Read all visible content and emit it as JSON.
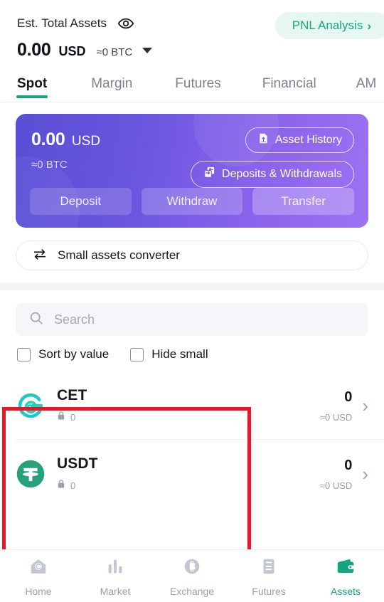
{
  "header": {
    "est_label": "Est. Total Assets",
    "eye_icon": "eye-icon",
    "amount": "0.00",
    "currency": "USD",
    "btc_equiv": "≈0 BTC",
    "caret_icon": "chevron-down-icon",
    "pnl_label": "PNL Analysis",
    "pnl_chevron": "›"
  },
  "tabs": [
    {
      "label": "Spot",
      "active": true
    },
    {
      "label": "Margin",
      "active": false
    },
    {
      "label": "Futures",
      "active": false
    },
    {
      "label": "Financial",
      "active": false
    },
    {
      "label": "AM",
      "active": false
    }
  ],
  "card": {
    "amount": "0.00",
    "currency": "USD",
    "btc_equiv": "≈0  BTC",
    "asset_history_label": "Asset History",
    "asset_history_icon": "document-upload-icon",
    "deposits_withdrawals_label": "Deposits & Withdrawals",
    "deposits_withdrawals_icon": "transfer-pages-icon",
    "actions": [
      {
        "label": "Deposit"
      },
      {
        "label": "Withdraw"
      },
      {
        "label": "Transfer"
      }
    ],
    "gradient_from": "#584ed4",
    "gradient_to": "#9d72f2"
  },
  "converter": {
    "icon": "swap-arrows-icon",
    "label": "Small assets converter"
  },
  "search": {
    "icon": "search-icon",
    "placeholder": "Search",
    "value": ""
  },
  "filters": [
    {
      "label": "Sort by value",
      "checked": false
    },
    {
      "label": "Hide small",
      "checked": false
    }
  ],
  "assets": [
    {
      "symbol": "CET",
      "icon": "cet-coin-icon",
      "lock_icon": "lock-icon",
      "locked": "0",
      "value": "0",
      "usd": "≈0 USD",
      "chevron": "›"
    },
    {
      "symbol": "USDT",
      "icon": "usdt-coin-icon",
      "lock_icon": "lock-icon",
      "locked": "0",
      "value": "0",
      "usd": "≈0 USD",
      "chevron": "›"
    }
  ],
  "bottom_nav": [
    {
      "label": "Home",
      "icon": "home-icon",
      "active": false
    },
    {
      "label": "Market",
      "icon": "bar-chart-icon",
      "active": false
    },
    {
      "label": "Exchange",
      "icon": "bitcoin-circle-icon",
      "active": false
    },
    {
      "label": "Futures",
      "icon": "contract-doc-icon",
      "active": false
    },
    {
      "label": "Assets",
      "icon": "wallet-icon",
      "active": true
    }
  ],
  "highlights": {
    "color": "#e8182a",
    "regions": [
      {
        "name": "asset-list-highlight"
      },
      {
        "name": "assets-tab-highlight"
      }
    ]
  },
  "accent": {
    "teal": "#17a382",
    "mint_bg": "#e6f7f1",
    "muted": "#9aa0aa"
  }
}
